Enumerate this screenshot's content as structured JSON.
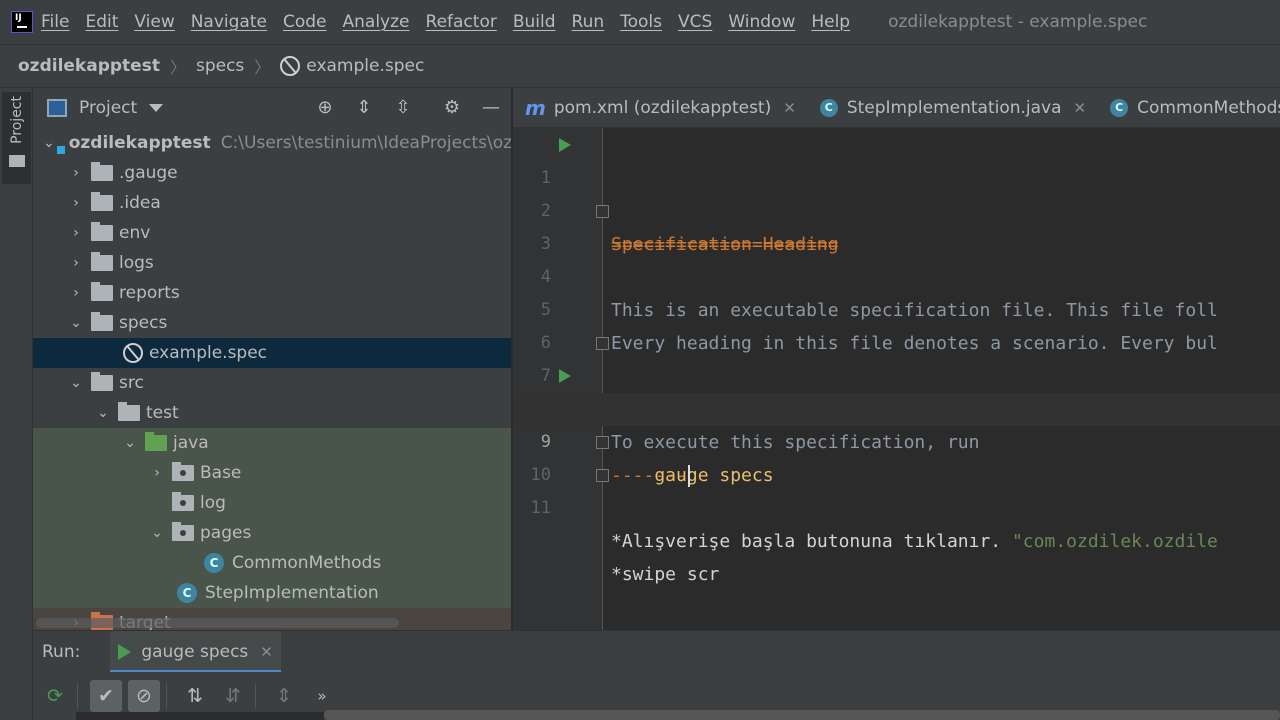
{
  "menu": {
    "items": [
      "File",
      "Edit",
      "View",
      "Navigate",
      "Code",
      "Analyze",
      "Refactor",
      "Build",
      "Run",
      "Tools",
      "VCS",
      "Window",
      "Help"
    ],
    "window_title": "ozdilekapptest - example.spec"
  },
  "breadcrumbs": {
    "project": "ozdilekapptest",
    "folder": "specs",
    "file": "example.spec"
  },
  "left_strip": {
    "project_label": "Project"
  },
  "project_panel": {
    "title": "Project",
    "tree": [
      {
        "label": "ozdilekapptest",
        "path": "C:\\Users\\testinium\\IdeaProjects\\ozd"
      },
      {
        "label": ".gauge"
      },
      {
        "label": ".idea"
      },
      {
        "label": "env"
      },
      {
        "label": "logs"
      },
      {
        "label": "reports"
      },
      {
        "label": "specs"
      },
      {
        "label": "example.spec"
      },
      {
        "label": "src"
      },
      {
        "label": "test"
      },
      {
        "label": "java"
      },
      {
        "label": "Base"
      },
      {
        "label": "log"
      },
      {
        "label": "pages"
      },
      {
        "label": "CommonMethods"
      },
      {
        "label": "StepImplementation"
      },
      {
        "label": "target"
      }
    ]
  },
  "tabs": [
    {
      "label": "pom.xml (ozdilekapptest)"
    },
    {
      "label": "StepImplementation.java"
    },
    {
      "label": "CommonMethods.java"
    }
  ],
  "editor": {
    "lines": [
      {
        "n": "1",
        "text": "Specification Heading"
      },
      {
        "n": "2",
        "text": "====================="
      },
      {
        "n": "3",
        "text": ""
      },
      {
        "n": "4",
        "text": "This is an executable specification file. This file foll"
      },
      {
        "n": "5",
        "text": "Every heading in this file denotes a scenario. Every bul"
      },
      {
        "n": "6",
        "text": ""
      },
      {
        "n": "7",
        "text": "To execute this specification, run"
      },
      {
        "n": "8",
        "text": "    gauge specs"
      },
      {
        "n": "9",
        "text": "-------"
      },
      {
        "n": "10",
        "text": "*Alışverişe başla butonuna tıklanır. ",
        "string": "\"com.ozdilek.ozdile"
      },
      {
        "n": "11",
        "text": "*swipe scr"
      }
    ]
  },
  "run_panel": {
    "label": "Run:",
    "tab_label": "gauge specs"
  },
  "icons": {
    "rerun": "rerun-icon",
    "show_passed": "check-icon",
    "show_ignored": "cancel-icon",
    "sort_alpha": "sort-alpha-icon",
    "sort_duration": "sort-duration-icon",
    "expand": "expand-all-icon",
    "more": "more-icon"
  }
}
